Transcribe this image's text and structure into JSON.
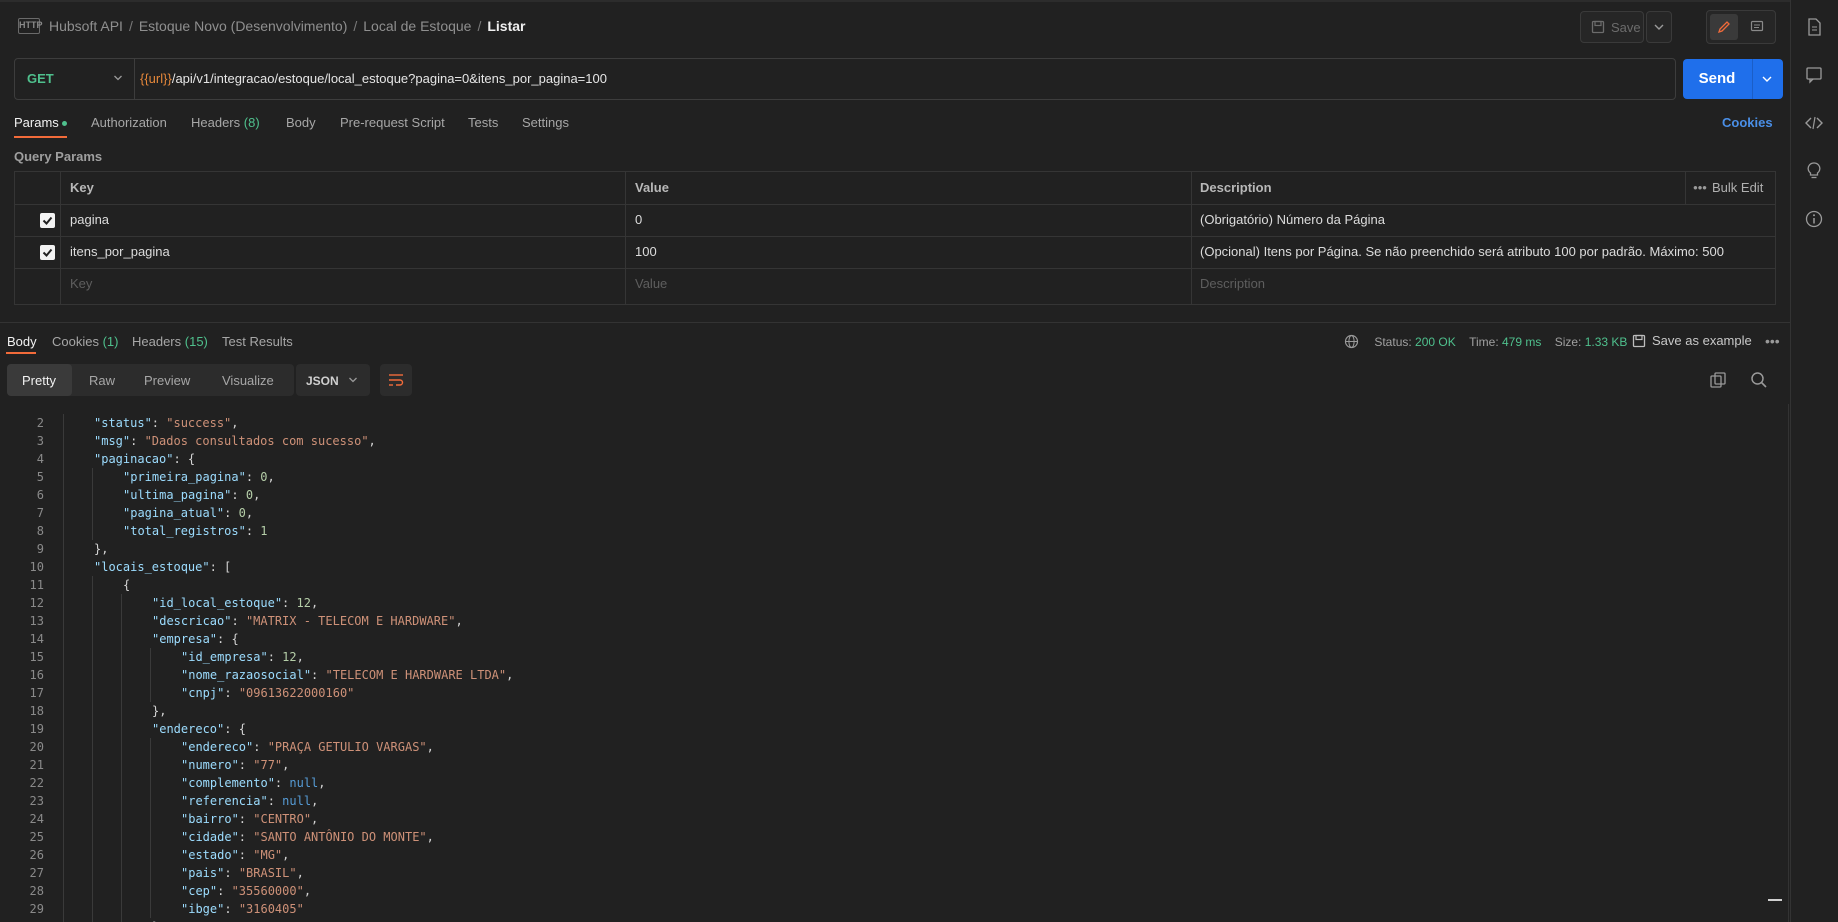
{
  "header": {
    "badge": "HTTP",
    "breadcrumb": [
      "Hubsoft API",
      "Estoque Novo (Desenvolvimento)",
      "Local de Estoque",
      "Listar"
    ],
    "save_label": "Save"
  },
  "request": {
    "method": "GET",
    "url_var": "{{url}}",
    "url_path": "/api/v1/integracao/estoque/local_estoque?pagina=0&itens_por_pagina=100",
    "send_label": "Send"
  },
  "request_tabs": {
    "params": "Params",
    "authorization": "Authorization",
    "headers": "Headers",
    "headers_count": "(8)",
    "body": "Body",
    "prerequest": "Pre-request Script",
    "tests": "Tests",
    "settings": "Settings",
    "cookies": "Cookies"
  },
  "query_params": {
    "title": "Query Params",
    "headers": {
      "key": "Key",
      "value": "Value",
      "description": "Description",
      "bulk_edit": "Bulk Edit"
    },
    "rows": [
      {
        "key": "pagina",
        "value": "0",
        "description": "(Obrigatório) Número da Página"
      },
      {
        "key": "itens_por_pagina",
        "value": "100",
        "description": "(Opcional) Itens por Página. Se não preenchido será atributo 100 por padrão. Máximo: 500"
      }
    ],
    "placeholder": {
      "key": "Key",
      "value": "Value",
      "description": "Description"
    }
  },
  "response_tabs": {
    "body": "Body",
    "cookies": "Cookies",
    "cookies_count": "(1)",
    "headers": "Headers",
    "headers_count": "(15)",
    "test_results": "Test Results"
  },
  "response_meta": {
    "status_label": "Status:",
    "status": "200 OK",
    "time_label": "Time:",
    "time": "479 ms",
    "size_label": "Size:",
    "size": "1.33 KB",
    "save_example": "Save as example"
  },
  "view_modes": [
    "Pretty",
    "Raw",
    "Preview",
    "Visualize"
  ],
  "format": "JSON",
  "code_lines": [
    {
      "n": "2",
      "indent": 1,
      "parts": [
        [
          "k",
          "\"status\""
        ],
        [
          "p",
          ": "
        ],
        [
          "s",
          "\"success\""
        ],
        [
          "p",
          ","
        ]
      ]
    },
    {
      "n": "3",
      "indent": 1,
      "parts": [
        [
          "k",
          "\"msg\""
        ],
        [
          "p",
          ": "
        ],
        [
          "s",
          "\"Dados consultados com sucesso\""
        ],
        [
          "p",
          ","
        ]
      ]
    },
    {
      "n": "4",
      "indent": 1,
      "parts": [
        [
          "k",
          "\"paginacao\""
        ],
        [
          "p",
          ": {"
        ]
      ]
    },
    {
      "n": "5",
      "indent": 2,
      "parts": [
        [
          "k",
          "\"primeira_pagina\""
        ],
        [
          "p",
          ": "
        ],
        [
          "n",
          "0"
        ],
        [
          "p",
          ","
        ]
      ]
    },
    {
      "n": "6",
      "indent": 2,
      "parts": [
        [
          "k",
          "\"ultima_pagina\""
        ],
        [
          "p",
          ": "
        ],
        [
          "n",
          "0"
        ],
        [
          "p",
          ","
        ]
      ]
    },
    {
      "n": "7",
      "indent": 2,
      "parts": [
        [
          "k",
          "\"pagina_atual\""
        ],
        [
          "p",
          ": "
        ],
        [
          "n",
          "0"
        ],
        [
          "p",
          ","
        ]
      ]
    },
    {
      "n": "8",
      "indent": 2,
      "parts": [
        [
          "k",
          "\"total_registros\""
        ],
        [
          "p",
          ": "
        ],
        [
          "n",
          "1"
        ]
      ]
    },
    {
      "n": "9",
      "indent": 1,
      "parts": [
        [
          "p",
          "},"
        ]
      ]
    },
    {
      "n": "10",
      "indent": 1,
      "parts": [
        [
          "k",
          "\"locais_estoque\""
        ],
        [
          "p",
          ": ["
        ]
      ]
    },
    {
      "n": "11",
      "indent": 2,
      "parts": [
        [
          "p",
          "{"
        ]
      ]
    },
    {
      "n": "12",
      "indent": 3,
      "parts": [
        [
          "k",
          "\"id_local_estoque\""
        ],
        [
          "p",
          ": "
        ],
        [
          "n",
          "12"
        ],
        [
          "p",
          ","
        ]
      ]
    },
    {
      "n": "13",
      "indent": 3,
      "parts": [
        [
          "k",
          "\"descricao\""
        ],
        [
          "p",
          ": "
        ],
        [
          "s",
          "\"MATRIX - TELECOM E HARDWARE\""
        ],
        [
          "p",
          ","
        ]
      ]
    },
    {
      "n": "14",
      "indent": 3,
      "parts": [
        [
          "k",
          "\"empresa\""
        ],
        [
          "p",
          ": {"
        ]
      ]
    },
    {
      "n": "15",
      "indent": 4,
      "parts": [
        [
          "k",
          "\"id_empresa\""
        ],
        [
          "p",
          ": "
        ],
        [
          "n",
          "12"
        ],
        [
          "p",
          ","
        ]
      ]
    },
    {
      "n": "16",
      "indent": 4,
      "parts": [
        [
          "k",
          "\"nome_razaosocial\""
        ],
        [
          "p",
          ": "
        ],
        [
          "s",
          "\"TELECOM E HARDWARE LTDA\""
        ],
        [
          "p",
          ","
        ]
      ]
    },
    {
      "n": "17",
      "indent": 4,
      "parts": [
        [
          "k",
          "\"cnpj\""
        ],
        [
          "p",
          ": "
        ],
        [
          "s",
          "\"09613622000160\""
        ]
      ]
    },
    {
      "n": "18",
      "indent": 3,
      "parts": [
        [
          "p",
          "},"
        ]
      ]
    },
    {
      "n": "19",
      "indent": 3,
      "parts": [
        [
          "k",
          "\"endereco\""
        ],
        [
          "p",
          ": {"
        ]
      ]
    },
    {
      "n": "20",
      "indent": 4,
      "parts": [
        [
          "k",
          "\"endereco\""
        ],
        [
          "p",
          ": "
        ],
        [
          "s",
          "\"PRAÇA GETULIO VARGAS\""
        ],
        [
          "p",
          ","
        ]
      ]
    },
    {
      "n": "21",
      "indent": 4,
      "parts": [
        [
          "k",
          "\"numero\""
        ],
        [
          "p",
          ": "
        ],
        [
          "s",
          "\"77\""
        ],
        [
          "p",
          ","
        ]
      ]
    },
    {
      "n": "22",
      "indent": 4,
      "parts": [
        [
          "k",
          "\"complemento\""
        ],
        [
          "p",
          ": "
        ],
        [
          "nl",
          "null"
        ],
        [
          "p",
          ","
        ]
      ]
    },
    {
      "n": "23",
      "indent": 4,
      "parts": [
        [
          "k",
          "\"referencia\""
        ],
        [
          "p",
          ": "
        ],
        [
          "nl",
          "null"
        ],
        [
          "p",
          ","
        ]
      ]
    },
    {
      "n": "24",
      "indent": 4,
      "parts": [
        [
          "k",
          "\"bairro\""
        ],
        [
          "p",
          ": "
        ],
        [
          "s",
          "\"CENTRO\""
        ],
        [
          "p",
          ","
        ]
      ]
    },
    {
      "n": "25",
      "indent": 4,
      "parts": [
        [
          "k",
          "\"cidade\""
        ],
        [
          "p",
          ": "
        ],
        [
          "s",
          "\"SANTO ANTÔNIO DO MONTE\""
        ],
        [
          "p",
          ","
        ]
      ]
    },
    {
      "n": "26",
      "indent": 4,
      "parts": [
        [
          "k",
          "\"estado\""
        ],
        [
          "p",
          ": "
        ],
        [
          "s",
          "\"MG\""
        ],
        [
          "p",
          ","
        ]
      ]
    },
    {
      "n": "27",
      "indent": 4,
      "parts": [
        [
          "k",
          "\"pais\""
        ],
        [
          "p",
          ": "
        ],
        [
          "s",
          "\"BRASIL\""
        ],
        [
          "p",
          ","
        ]
      ]
    },
    {
      "n": "28",
      "indent": 4,
      "parts": [
        [
          "k",
          "\"cep\""
        ],
        [
          "p",
          ": "
        ],
        [
          "s",
          "\"35560000\""
        ],
        [
          "p",
          ","
        ]
      ]
    },
    {
      "n": "29",
      "indent": 4,
      "parts": [
        [
          "k",
          "\"ibge\""
        ],
        [
          "p",
          ": "
        ],
        [
          "s",
          "\"3160405\""
        ]
      ]
    },
    {
      "n": "30",
      "indent": 3,
      "parts": [
        [
          "p",
          "}"
        ]
      ]
    }
  ],
  "icons": {
    "rail": [
      "document-icon",
      "comment-icon",
      "code-icon",
      "lightbulb-icon",
      "info-icon"
    ],
    "accent": "#f26b3a",
    "send": "#1f6feb",
    "success": "#4fc08d"
  }
}
